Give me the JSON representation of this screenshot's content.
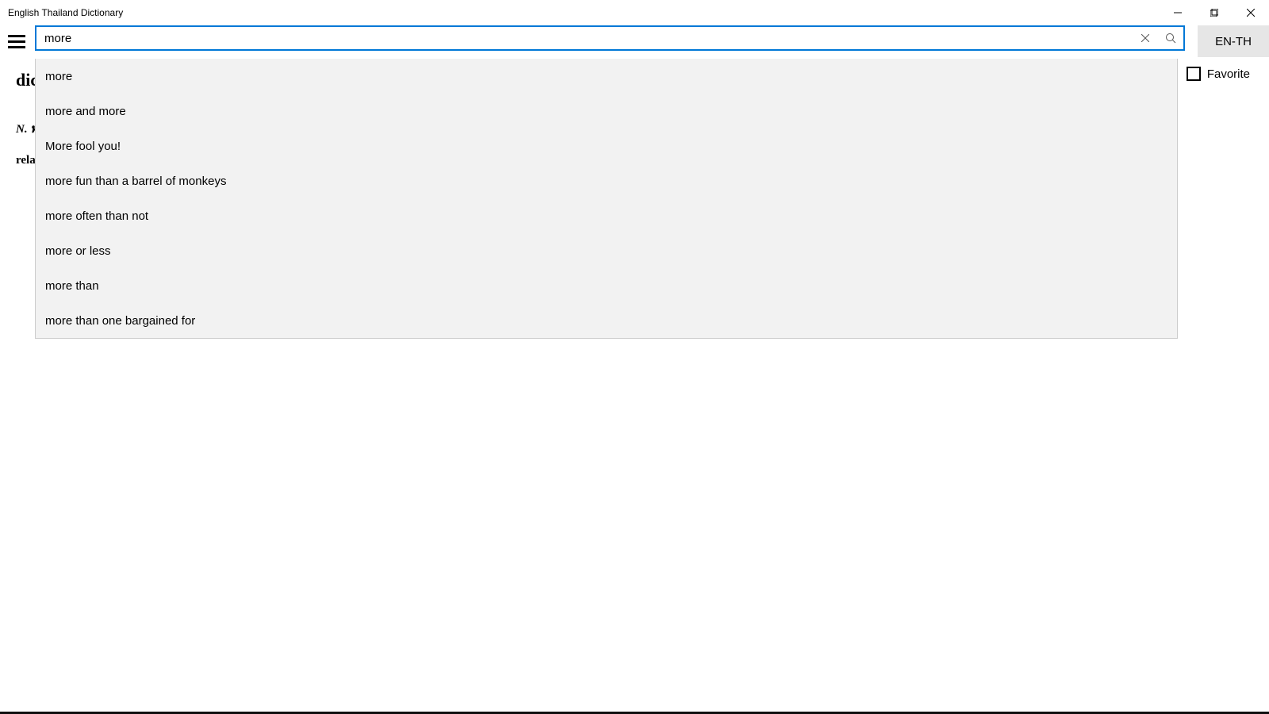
{
  "window": {
    "title": "English Thailand Dictionary"
  },
  "toolbar": {
    "search_value": "more",
    "lang_toggle": "EN-TH"
  },
  "favorite": {
    "label": "Favorite",
    "checked": false
  },
  "entry": {
    "headword_partial": "dic",
    "pos_prefix": "N.",
    "pos_thai_partial": "พ",
    "related_partial": "rela"
  },
  "suggestions": [
    "more",
    "more and more",
    "More fool you!",
    "more fun than a barrel of monkeys",
    "more often than not",
    "more or less",
    "more than",
    "more than one bargained for"
  ]
}
